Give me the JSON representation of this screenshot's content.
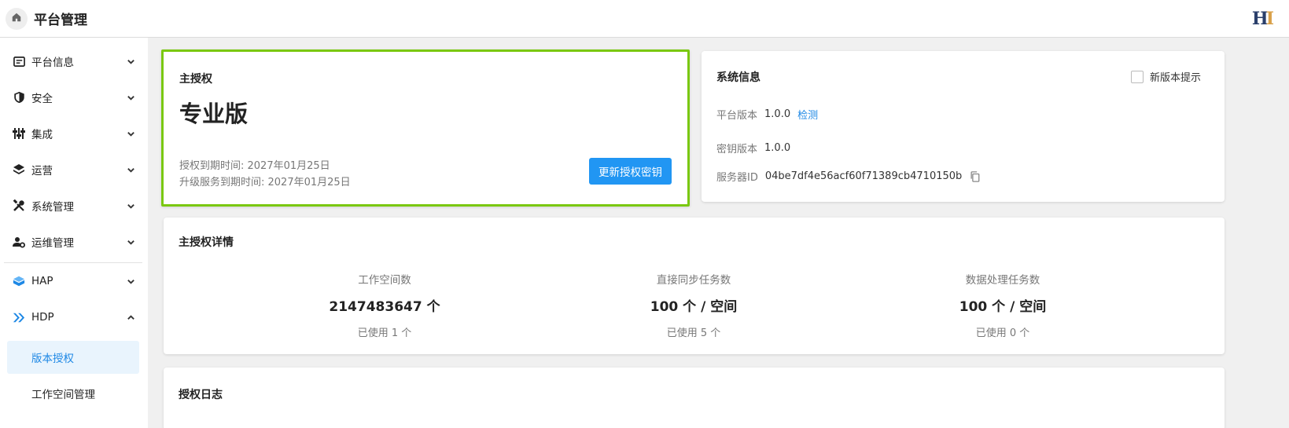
{
  "header": {
    "title": "平台管理",
    "logo_text": "H",
    "logo_accent": "I"
  },
  "sidebar": {
    "items": [
      {
        "label": "平台信息",
        "icon": "info-card-icon"
      },
      {
        "label": "安全",
        "icon": "shield-icon"
      },
      {
        "label": "集成",
        "icon": "sliders-icon"
      },
      {
        "label": "运营",
        "icon": "layers-icon"
      },
      {
        "label": "系统管理",
        "icon": "tools-icon"
      },
      {
        "label": "运维管理",
        "icon": "user-gear-icon"
      },
      {
        "label": "HAP",
        "icon": "hap-cube-icon"
      },
      {
        "label": "HDP",
        "icon": "hdp-chevrons-icon"
      }
    ],
    "sub_items": [
      {
        "label": "版本授权",
        "active": true
      },
      {
        "label": "工作空间管理",
        "active": false
      }
    ]
  },
  "license": {
    "title": "主授权",
    "edition": "专业版",
    "expire": "授权到期时间: 2027年01月25日",
    "upgrade_expire": "升级服务到期时间: 2027年01月25日",
    "renew_button": "更新授权密钥"
  },
  "system": {
    "title": "系统信息",
    "new_version_hint": "新版本提示",
    "platform_version_label": "平台版本",
    "platform_version": "1.0.0",
    "check_link": "检测",
    "key_version_label": "密钥版本",
    "key_version": "1.0.0",
    "server_id_label": "服务器ID",
    "server_id": "04be7df4e56acf60f71389cb4710150b"
  },
  "details": {
    "title": "主授权详情",
    "stats": [
      {
        "label": "工作空间数",
        "value": "2147483647 个",
        "used": "已使用 1 个"
      },
      {
        "label": "直接同步任务数",
        "value": "100 个 / 空间",
        "used": "已使用 5 个"
      },
      {
        "label": "数据处理任务数",
        "value": "100 个 / 空间",
        "used": "已使用 0 个"
      }
    ]
  },
  "log": {
    "title": "授权日志"
  },
  "colors": {
    "accent": "#2196f3",
    "highlight_border": "#7ac810",
    "active_bg": "#e9f4fd",
    "hap_blue": "#1e88e5"
  }
}
